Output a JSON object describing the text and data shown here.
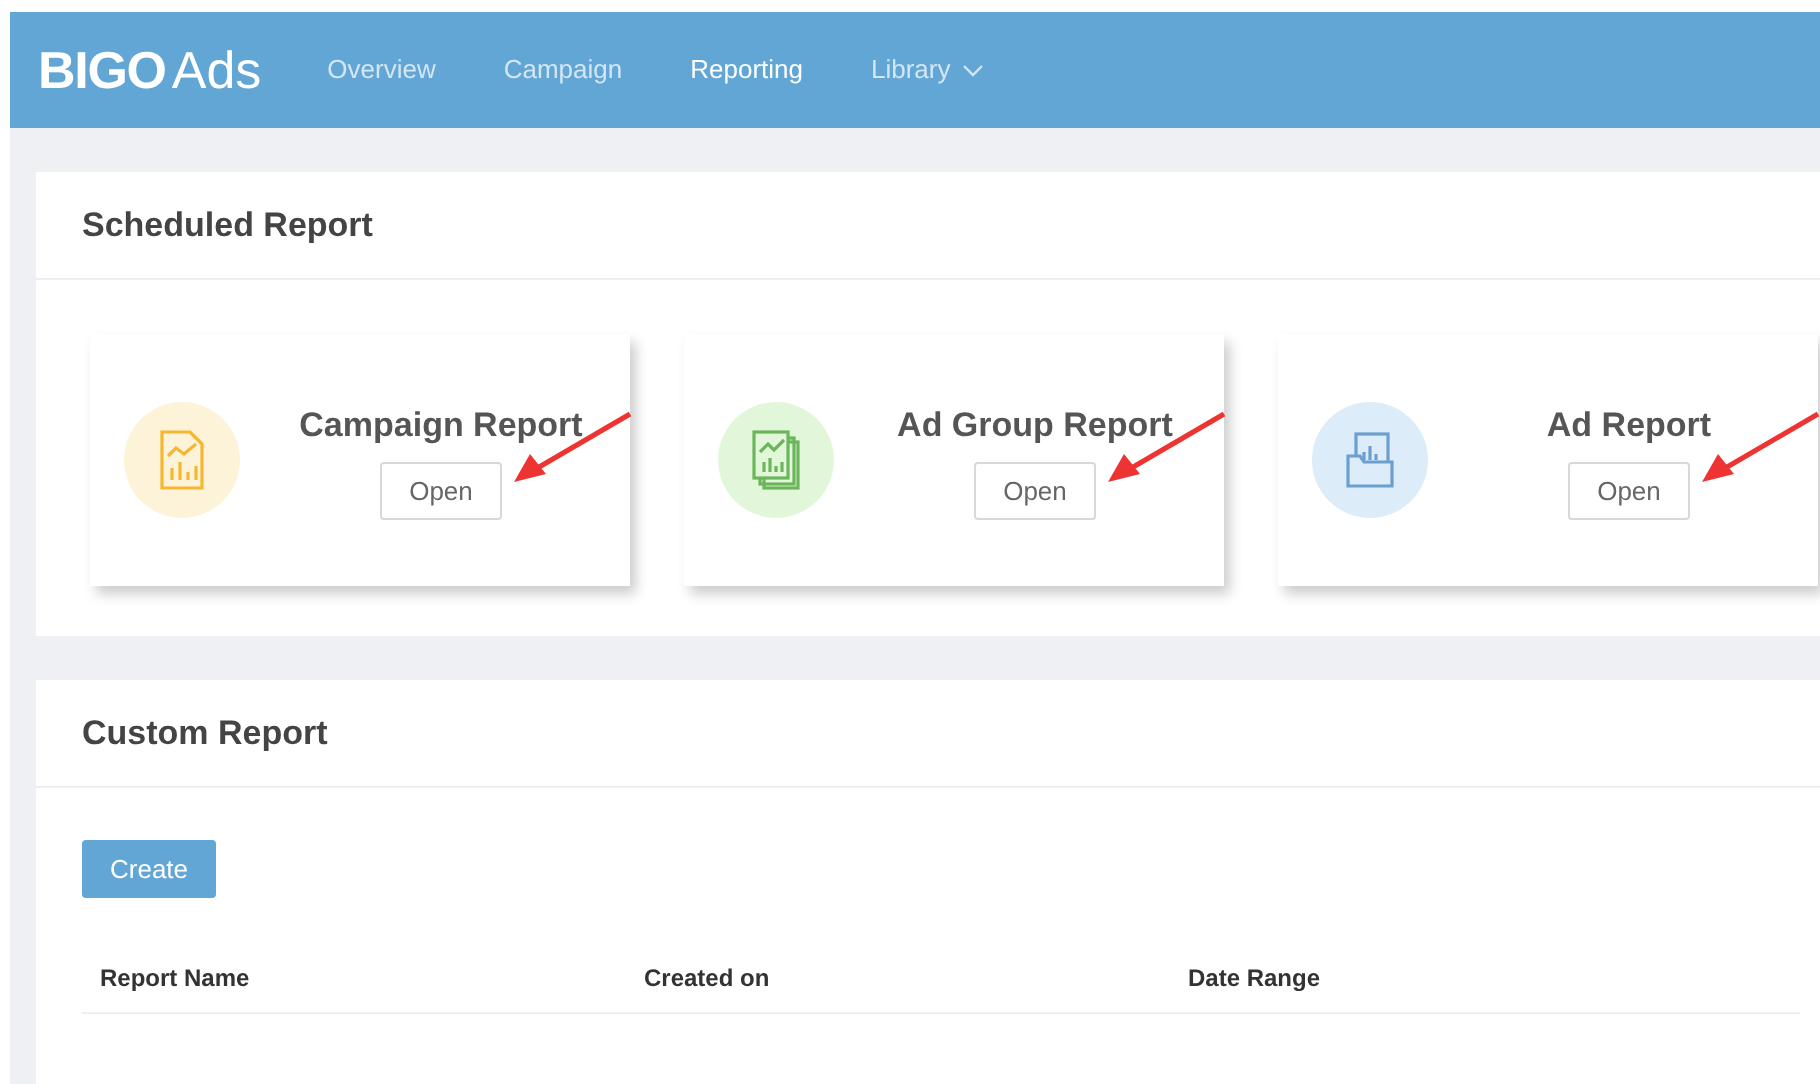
{
  "brand": {
    "logo": "BIGO",
    "suffix": "Ads"
  },
  "nav": [
    {
      "label": "Overview",
      "selected": false,
      "dropdown": false
    },
    {
      "label": "Campaign",
      "selected": false,
      "dropdown": false
    },
    {
      "label": "Reporting",
      "selected": true,
      "dropdown": false
    },
    {
      "label": "Library",
      "selected": false,
      "dropdown": true
    }
  ],
  "scheduled_report": {
    "title": "Scheduled Report",
    "cards": [
      {
        "kind": "campaign",
        "title": "Campaign Report",
        "button": "Open"
      },
      {
        "kind": "ad-group",
        "title": "Ad Group Report",
        "button": "Open"
      },
      {
        "kind": "ad",
        "title": "Ad Report",
        "button": "Open"
      }
    ]
  },
  "custom_report": {
    "title": "Custom Report",
    "create_button": "Create",
    "table": {
      "columns": [
        "Report Name",
        "Created on",
        "Date Range"
      ]
    }
  }
}
